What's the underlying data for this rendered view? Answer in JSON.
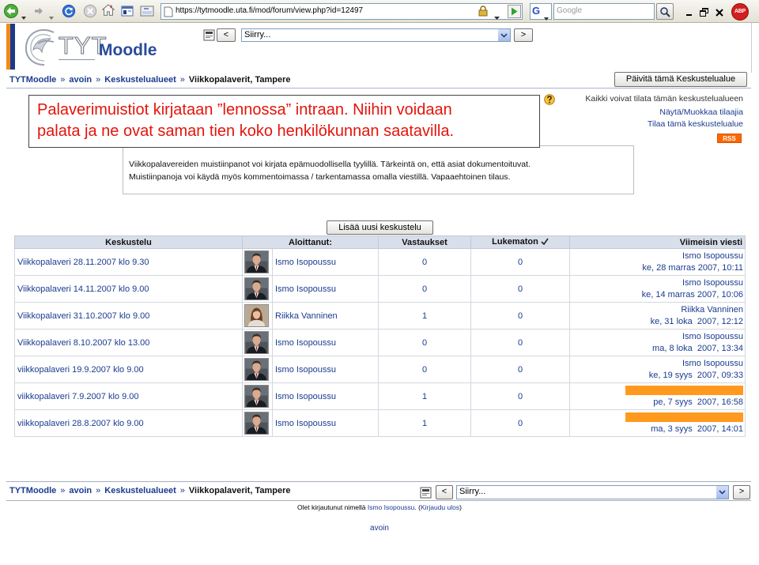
{
  "browser": {
    "url": "https://tytmoodle.uta.fi/mod/forum/view.php?id=12497",
    "search_engine": "G",
    "search_placeholder": "Google",
    "adblock_badge": "ABP",
    "toolbar_icons": [
      "back-icon",
      "forward-icon",
      "refresh-icon",
      "stop-icon",
      "home-icon",
      "page-icon",
      "tag-icon"
    ],
    "window_controls": [
      "minimize-icon",
      "restore-icon",
      "close-icon"
    ]
  },
  "site": {
    "logo_tyt": "TYT",
    "logo_moodle": "Moodle"
  },
  "jump_menu": {
    "selected": "Siirry...",
    "prev_label": "<",
    "next_label": ">"
  },
  "breadcrumb": {
    "items": [
      "TYTMoodle",
      "avoin",
      "Keskustelualueet",
      "Viikkopalaverit, Tampere"
    ],
    "separator": "»"
  },
  "update_forum_button": "Päivitä tämä Keskustelualue",
  "callout": {
    "lines": [
      "Palaverimuistiot kirjataan ”lennossa” intraan. Niihin voidaan",
      "palata ja ne ovat saman tien koko henkilökunnan saatavilla."
    ]
  },
  "subscription": {
    "help_icon": "help-icon",
    "mode_text": "Kaikki voivat tilata tämän keskustelualueen",
    "show_subscribers_link": "Näytä/Muokkaa tilaajia",
    "subscribe_link": "Tilaa tämä keskustelualue",
    "rss_label": "RSS"
  },
  "intro": {
    "lines": [
      "Viikkopalavereiden muistiinpanot voi kirjata epämuodollisella tyylillä. Tärkeintä on, että asiat dokumentoituvat.",
      "Muistiinpanoja voi käydä myös kommentoimassa / tarkentamassa omalla viestillä. Vapaaehtoinen tilaus."
    ]
  },
  "add_discussion_button": "Lisää uusi keskustelu",
  "table": {
    "headers": {
      "discussion": "Keskustelu",
      "started_by": "Aloittanut:",
      "replies": "Vastaukset",
      "unread": "Lukematon",
      "last_post": "Viimeisin viesti"
    },
    "unread_header_icon": "checkmark-icon",
    "rows": [
      {
        "topic": "Viikkopalaveri 28.11.2007 klo 9.30",
        "avatar": "male-avatar-photo",
        "author": "Ismo Isopoussu",
        "replies": 0,
        "unread": 0,
        "last_post": {
          "author": "Ismo Isopoussu",
          "date": "ke, 28 marras 2007, 10:11"
        }
      },
      {
        "topic": "Viikkopalaveri 14.11.2007 klo 9.00",
        "avatar": "male-avatar-photo",
        "author": "Ismo Isopoussu",
        "replies": 0,
        "unread": 0,
        "last_post": {
          "author": "Ismo Isopoussu",
          "date": "ke, 14 marras 2007, 10:06"
        }
      },
      {
        "topic": "Viikkopalaveri 31.10.2007 klo 9.00",
        "avatar": "female-avatar-photo",
        "author": "Riikka Vanninen",
        "replies": 1,
        "unread": 0,
        "last_post": {
          "author": "Riikka Vanninen",
          "date": "ke, 31 loka  2007, 12:12"
        }
      },
      {
        "topic": "Viikkopalaveri 8.10.2007 klo 13.00",
        "avatar": "male-avatar-photo",
        "author": "Ismo Isopoussu",
        "replies": 0,
        "unread": 0,
        "last_post": {
          "author": "Ismo Isopoussu",
          "date": "ma, 8 loka  2007, 13:34"
        }
      },
      {
        "topic": "viikkopalaveri 19.9.2007 klo 9.00",
        "avatar": "male-avatar-photo",
        "author": "Ismo Isopoussu",
        "replies": 0,
        "unread": 0,
        "last_post": {
          "author": "Ismo Isopoussu",
          "date": "ke, 19 syys  2007, 09:33"
        }
      },
      {
        "topic": "viikkopalaveri 7.9.2007 klo 9.00",
        "avatar": "male-avatar-photo",
        "author": "Ismo Isopoussu",
        "replies": 1,
        "unread": 0,
        "last_post": {
          "author_redacted": true,
          "date": "pe, 7 syys  2007, 16:58"
        }
      },
      {
        "topic": "viikkopalaveri 28.8.2007 klo 9.00",
        "avatar": "male-avatar-photo",
        "author": "Ismo Isopoussu",
        "replies": 1,
        "unread": 0,
        "last_post": {
          "author_redacted": true,
          "date": "ma, 3 syys  2007, 14:01"
        }
      }
    ]
  },
  "footer": {
    "login_prefix": "Olet kirjautunut nimellä ",
    "login_user": "Ismo Isopoussu",
    "login_middle": ". (",
    "logout_link": "Kirjaudu ulos",
    "login_suffix": ")",
    "course_link": "avoin"
  },
  "colors": {
    "link": "#1a3b8f",
    "callout_text": "#e4140b",
    "table_header_bg": "#d8dfeb",
    "redaction": "#ff9a1f",
    "rss": "#ff6600",
    "logo_blue": "#2a4a9a",
    "stripe_orange": "#f08a1c",
    "stripe_blue": "#1d3a8a"
  }
}
